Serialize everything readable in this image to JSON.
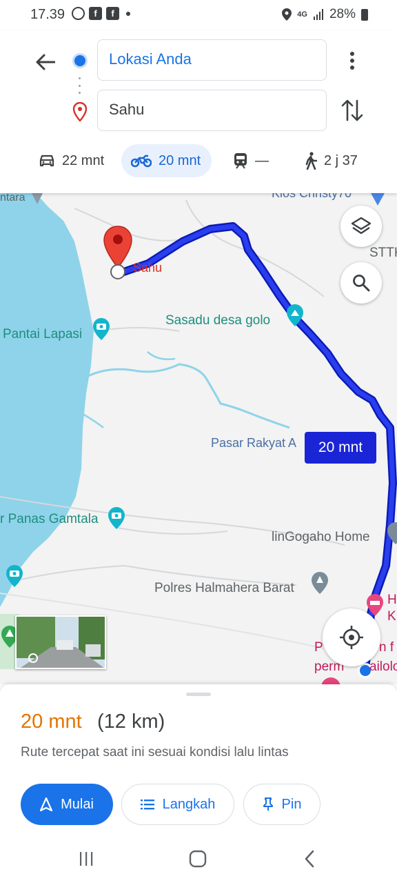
{
  "status_bar": {
    "time": "17.39",
    "network": "4G",
    "battery": "28%",
    "icons": [
      "whatsapp-icon",
      "facebook-icon",
      "facebook-icon",
      "notification-dot",
      "location-icon",
      "signal-icon",
      "battery-icon"
    ]
  },
  "directions": {
    "origin": "Lokasi Anda",
    "destination": "Sahu",
    "modes": [
      {
        "name": "car",
        "icon": "car-icon",
        "label": "22 mnt",
        "selected": false
      },
      {
        "name": "motorcycle",
        "icon": "motorcycle-icon",
        "label": "20 mnt",
        "selected": true
      },
      {
        "name": "transit",
        "icon": "train-icon",
        "label": "—",
        "selected": false
      },
      {
        "name": "walk",
        "icon": "walk-icon",
        "label": "2 j 37",
        "selected": false
      }
    ]
  },
  "map": {
    "labels": {
      "top_left": "ntara",
      "top_right": "Kios Christy70",
      "sttk": "STTK",
      "sahu": "Sahu",
      "sasadu": "Sasadu desa golo",
      "pantai": "Pantai Lapasi",
      "pasar": "Pasar Rakyat A",
      "panas": "r Panas Gamtala",
      "lingogaho": "linGogaho Home",
      "polres": "Polres Halmahera Barat",
      "hotel_partial": "H K",
      "pink_partial_1": "P",
      "pink_partial_2": "n f",
      "pink_partial_3": "perm",
      "pink_partial_4": "ailolo"
    },
    "route_time": "20 mnt",
    "route_color": "#1a25d6",
    "water_color": "#8ed3ea"
  },
  "summary": {
    "time": "20 mnt",
    "distance": "(12 km)",
    "description": "Rute tercepat saat ini sesuai kondisi lalu lintas",
    "start_label": "Mulai",
    "steps_label": "Langkah",
    "pin_label": "Pin",
    "accent": "#1a73e8",
    "time_color": "#e37400"
  }
}
